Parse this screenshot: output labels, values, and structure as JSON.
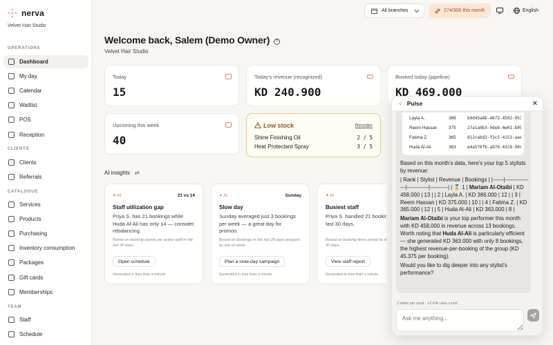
{
  "app": {
    "name": "nerva",
    "org": "Velvet Hair Studio"
  },
  "topbar": {
    "branch": "All branches",
    "usage": "274/300 this month",
    "language": "English"
  },
  "sidebar": {
    "sections": [
      {
        "label": "OPERATIONS",
        "items": [
          {
            "label": "Dashboard",
            "icon": "grid-icon",
            "active": true
          },
          {
            "label": "My day",
            "icon": "calendar-check-icon"
          },
          {
            "label": "Calendar",
            "icon": "calendar-icon"
          },
          {
            "label": "Waitlist",
            "icon": "clipboard-icon"
          },
          {
            "label": "POS",
            "icon": "scan-icon"
          },
          {
            "label": "Reception",
            "icon": "door-icon"
          }
        ]
      },
      {
        "label": "CLIENTS",
        "items": [
          {
            "label": "Clients",
            "icon": "users-icon"
          },
          {
            "label": "Referrals",
            "icon": "user-plus-icon"
          }
        ]
      },
      {
        "label": "CATALOGUE",
        "items": [
          {
            "label": "Services",
            "icon": "sparkles-icon"
          },
          {
            "label": "Products",
            "icon": "box-icon"
          },
          {
            "label": "Purchasing",
            "icon": "truck-icon"
          },
          {
            "label": "Inventory consumption",
            "icon": "layers-icon"
          },
          {
            "label": "Packages",
            "icon": "package-icon"
          },
          {
            "label": "Gift cards",
            "icon": "gift-icon"
          },
          {
            "label": "Memberships",
            "icon": "id-card-icon"
          }
        ]
      },
      {
        "label": "TEAM",
        "items": [
          {
            "label": "Staff",
            "icon": "user-gear-icon"
          },
          {
            "label": "Schedule",
            "icon": "clock-icon"
          }
        ]
      }
    ]
  },
  "page": {
    "title": "Welcome back, Salem (Demo Owner)",
    "subtitle": "Velvet Hair Studio"
  },
  "stats": {
    "today": {
      "label": "Today",
      "value": "15"
    },
    "revenue": {
      "label": "Today's revenue (recognized)",
      "value": "KD 240.900"
    },
    "booked": {
      "label": "Booked today (pipeline)",
      "value": "KD 469.000"
    },
    "upcoming": {
      "label": "Upcoming this week",
      "value": "40"
    }
  },
  "low_stock": {
    "title": "Low stock",
    "reorder": "Reorder",
    "items": [
      {
        "name": "Shine Finishing Oil",
        "qty": "2 / 5"
      },
      {
        "name": "Heat Protectant Spray",
        "qty": "3 / 5"
      }
    ]
  },
  "ai_insights": {
    "label": "AI insights",
    "badge": "AI",
    "cards": [
      {
        "meta": "21 vs 14",
        "title": "Staff utilization gap",
        "body": "Priya S. has 21 bookings while Huda Al-Ali has only 14 — consider rebalancing.",
        "note": "Based on booking counts per active staff in the last 30 days.",
        "button": "Open schedule",
        "generated": "Generated in less than a minute"
      },
      {
        "meta": "Sunday",
        "title": "Slow day",
        "body": "Sunday averaged just 3 bookings per week — a great day for promos.",
        "note": "Based on bookings in the last 28 days grouped by day of week.",
        "button": "Plan a slow-day campaign",
        "generated": "Generated in less than a minute"
      },
      {
        "meta": "",
        "title": "Busiest staff",
        "body": "Priya S. handled 21 bookings in the last 30 days.",
        "note": "Based on booking items joined to staff in the last 30 days.",
        "button": "View staff report",
        "generated": "Generated in less than a minute"
      }
    ]
  },
  "pulse": {
    "title": "Pulse",
    "table_rows": [
      {
        "name": "Layla A.",
        "num": "386",
        "id": "b9d45a8b-4672-4502-953"
      },
      {
        "name": "Reem Hassan",
        "num": "375",
        "id": "27a1a9b3-9deb-4e01-b092"
      },
      {
        "name": "Fatima Z.",
        "num": "365",
        "id": "d12cebd2-f3c5-4153-aae5-"
      },
      {
        "name": "Huda Al-Ali",
        "num": "363",
        "id": "e4a576fb-a970-43c8-904b"
      }
    ],
    "intro": "Based on this month's data, here's your top 5 stylists by revenue:",
    "table_raw_a": "| Rank | Stylist | Revenue | Bookings | |------|----------------|------------|----------| | 🥇 1 | ",
    "table_raw_b": "Mariam Al-Otaibi",
    "table_raw_c": " | KD 458.000 | 13 | | 2 | Layla A. | KD 386.000 | 12 | | 3 | Reem Hassan | KD 375.000 | 10 | | 4 | Fatima Z. | KD 365.000 | 12 | | 5 | Huda Al-Ali | KD 363.000 | 8 |",
    "p2_a": "Mariam Al-Otaibi",
    "p2_b": " is your top performer this month with KD 458.000 in revenue across 13 bookings. Worth noting that ",
    "p2_c": "Huda Al-Ali",
    "p2_d": " is particularly efficient — she generated KD 363.000 with only 8 bookings, the highest revenue-per-booking of the group (KD 45.375 per booking).",
    "p3": "Would you like to dig deeper into any stylist's performance?",
    "rate_note": "1 token per send · +2 if AI uses a tool",
    "placeholder": "Ask me anything..."
  }
}
